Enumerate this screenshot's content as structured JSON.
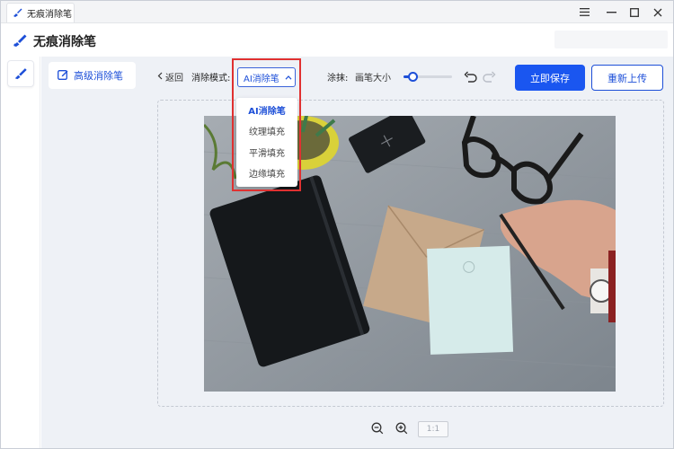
{
  "window": {
    "tab_title": "无痕消除笔",
    "controls": [
      "menu",
      "minimize",
      "maximize",
      "close"
    ]
  },
  "header": {
    "app_title": "无痕消除笔"
  },
  "sidebar": {
    "items": [
      {
        "label": "高级消除笔",
        "icon": "edit-icon",
        "active": true
      }
    ]
  },
  "toolbar": {
    "back_label": "返回",
    "mode_label": "消除模式:",
    "mode_value": "AI消除笔",
    "paint_label": "涂抹:",
    "brush_size_label": "画笔大小",
    "brush_size_fraction": 0.2,
    "save_label": "立即保存",
    "reupload_label": "重新上传"
  },
  "dropdown": {
    "options": [
      {
        "label": "AI消除笔",
        "selected": true
      },
      {
        "label": "纹理填充",
        "selected": false
      },
      {
        "label": "平滑填充",
        "selected": false
      },
      {
        "label": "边缘填充",
        "selected": false
      }
    ]
  },
  "zoom": {
    "ratio_label": "1:1"
  },
  "colors": {
    "accent": "#1a56f0",
    "highlight": "#e03131",
    "sidebar_bg": "#eef1f6"
  }
}
